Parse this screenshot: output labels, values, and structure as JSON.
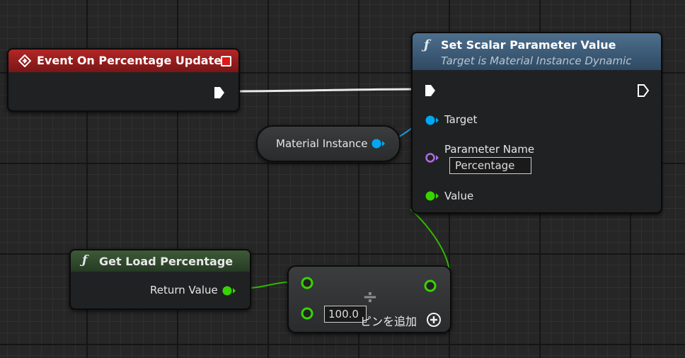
{
  "event_node": {
    "title": "Event On Percentage Updated",
    "header_color": "#8f1c1c",
    "icon": "event-diamond-icon",
    "delegate_icon": "red-square-icon"
  },
  "set_scalar_node": {
    "func_symbol": "ƒ",
    "title": "Set Scalar Parameter Value",
    "subtitle": "Target is Material Instance Dynamic",
    "header_color": "#3c5a75",
    "pins": {
      "target": "Target",
      "parameter_name": "Parameter Name",
      "parameter_value": "Percentage",
      "value": "Value"
    }
  },
  "material_node": {
    "label": "Material Instance"
  },
  "get_load_node": {
    "func_symbol": "ƒ",
    "title": "Get Load Percentage",
    "header_color": "#2f4a2c",
    "output_label": "Return Value"
  },
  "divide_node": {
    "operator": "÷",
    "input_b_value": "100.0",
    "add_pin_label": "ピンを追加",
    "add_pin_icon": "plus-circle-icon"
  },
  "colors": {
    "exec": "#ffffff",
    "object": "#00a8f4",
    "name": "#b26be6",
    "float": "#38d400"
  }
}
